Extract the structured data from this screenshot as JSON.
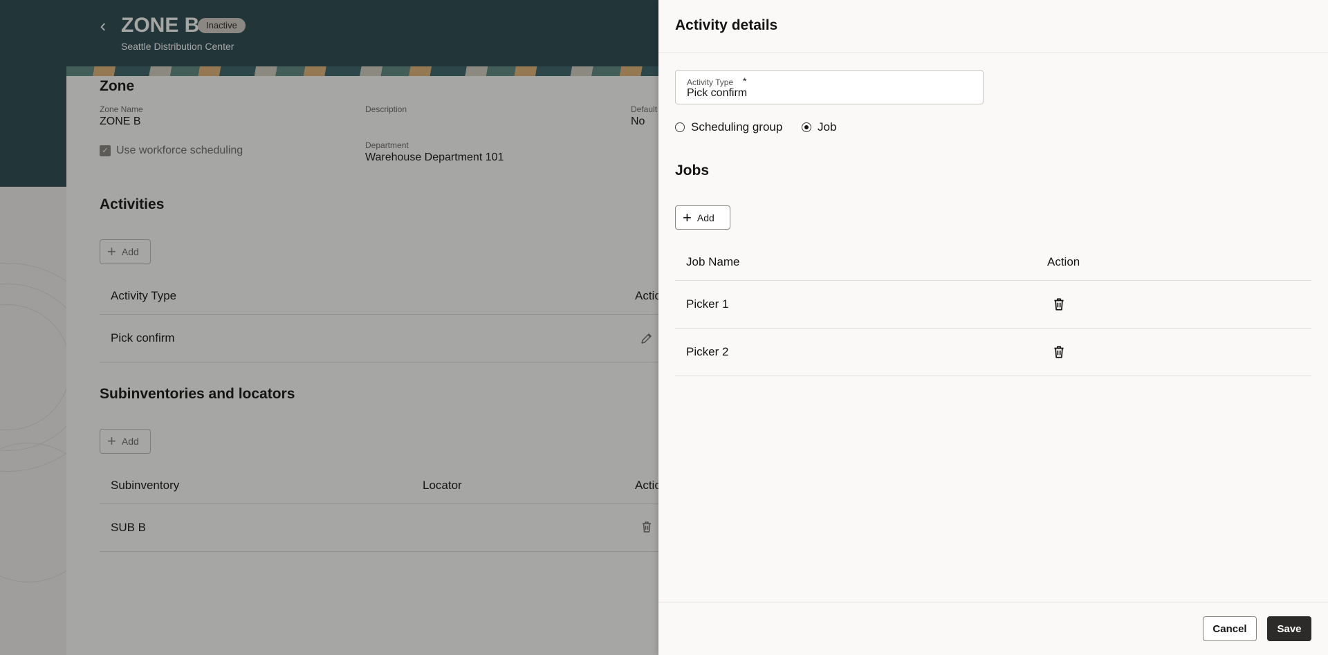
{
  "header": {
    "back_icon": "chevron-left-icon",
    "title": "ZONE B",
    "status": "Inactive",
    "subtitle": "Seattle Distribution Center"
  },
  "zone": {
    "section_title": "Zone",
    "name_label": "Zone Name",
    "name_value": "ZONE B",
    "description_label": "Description",
    "default_label": "Default",
    "default_value": "No",
    "department_label": "Department",
    "department_value": "Warehouse Department 101",
    "workforce_label": "Use workforce scheduling",
    "workforce_checked": true
  },
  "activities": {
    "section_title": "Activities",
    "add_label": "Add",
    "columns": [
      "Activity Type",
      "Action"
    ],
    "rows": [
      {
        "activity_type": "Pick confirm",
        "action_icon": "pencil-icon"
      }
    ]
  },
  "subinventories": {
    "section_title": "Subinventories and locators",
    "add_label": "Add",
    "columns": [
      "Subinventory",
      "Locator",
      "Action"
    ],
    "rows": [
      {
        "subinventory": "SUB B",
        "locator": "",
        "action_icon": "trash-icon"
      }
    ]
  },
  "drawer": {
    "title": "Activity details",
    "activity_type_label": "Activity Type",
    "required_mark": "*",
    "activity_type_value": "Pick confirm",
    "radio_options": [
      {
        "label": "Scheduling group",
        "selected": false
      },
      {
        "label": "Job",
        "selected": true
      }
    ],
    "jobs_title": "Jobs",
    "jobs_add_label": "Add",
    "jobs_columns": [
      "Job Name",
      "Action"
    ],
    "jobs_rows": [
      {
        "name": "Picker 1",
        "action_icon": "trash-icon"
      },
      {
        "name": "Picker 2",
        "action_icon": "trash-icon"
      }
    ],
    "cancel_label": "Cancel",
    "save_label": "Save"
  }
}
